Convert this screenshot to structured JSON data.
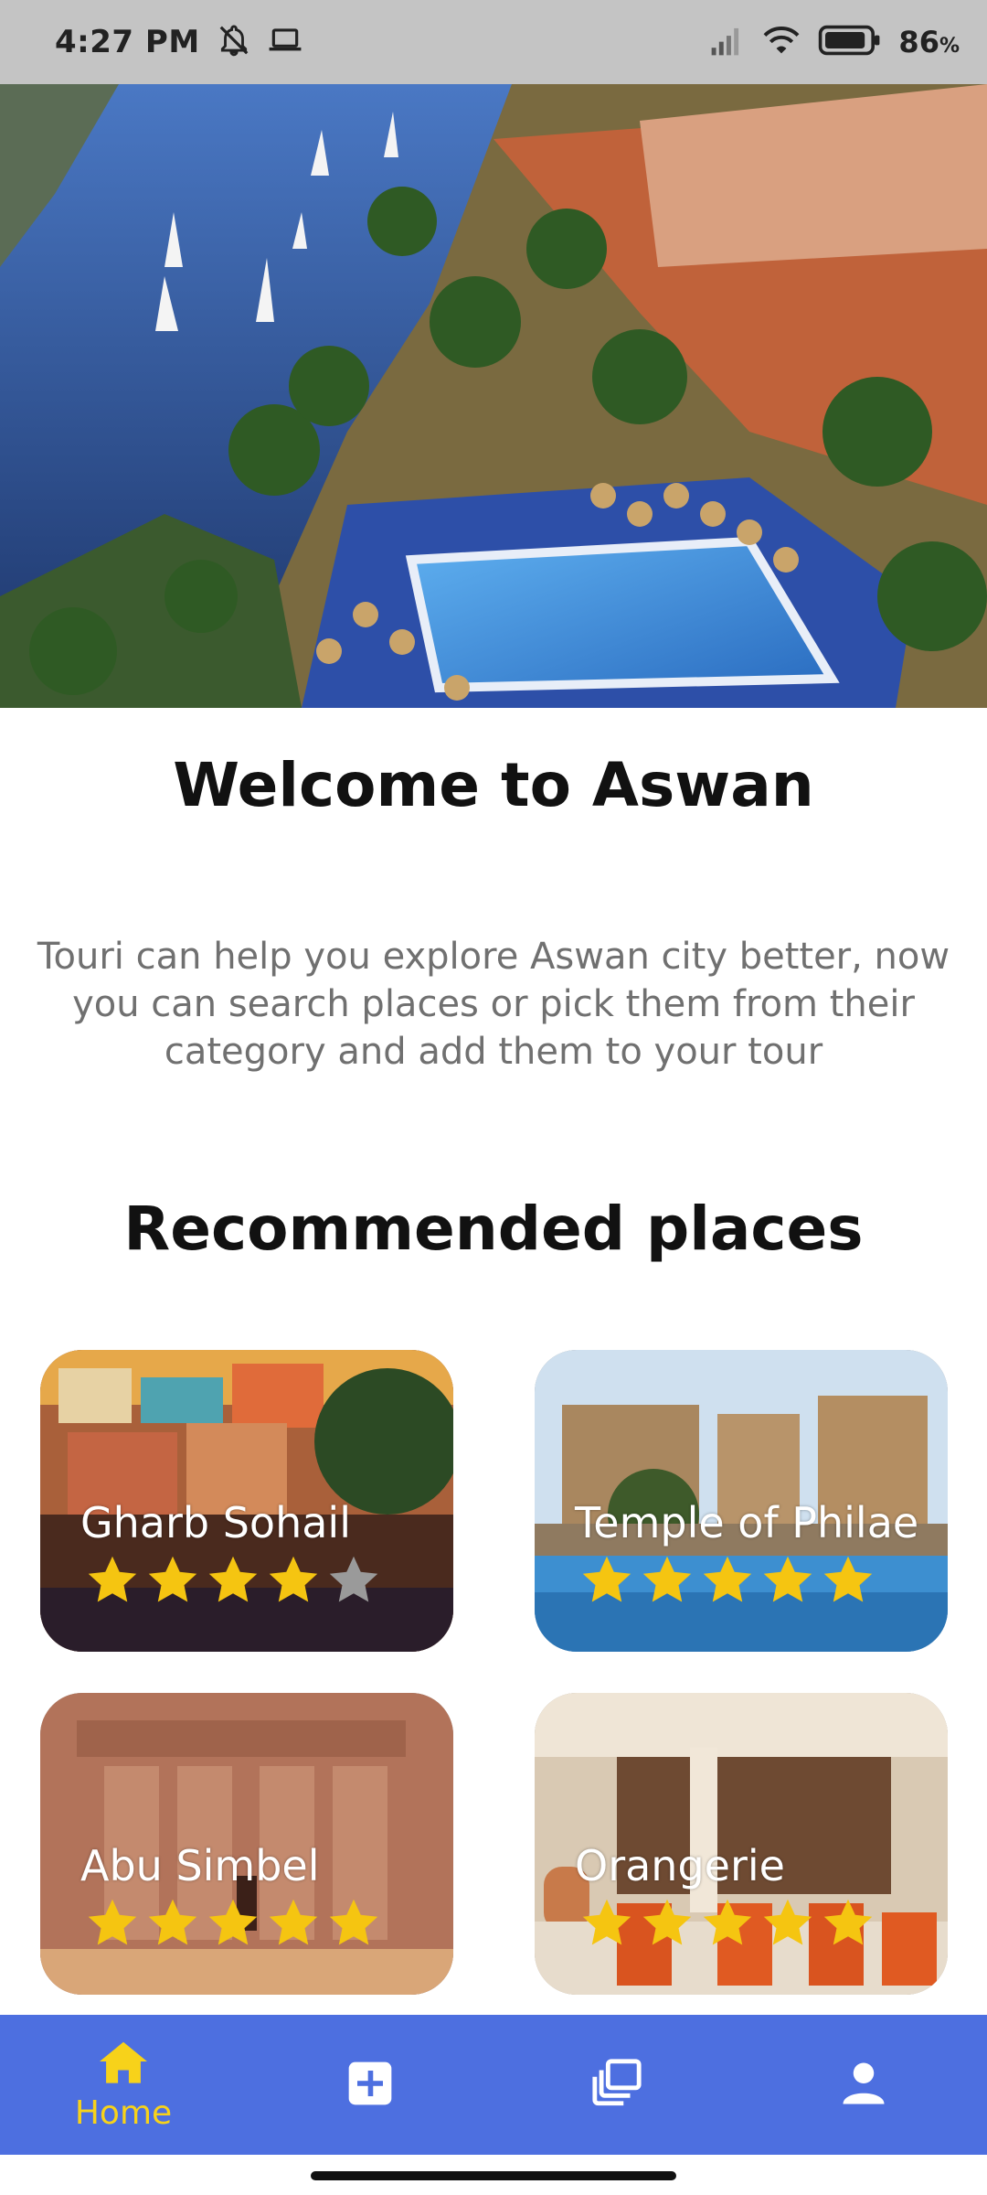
{
  "status_bar": {
    "time": "4:27 PM",
    "battery": "86",
    "battery_unit": "%",
    "icons": [
      "notifications-off-icon",
      "laptop-icon",
      "signal-icon",
      "wifi-icon",
      "battery-icon"
    ]
  },
  "hero": {
    "image": "aswan-nile-resort-photo"
  },
  "welcome": {
    "title": "Welcome to Aswan",
    "text": "Touri can help you explore Aswan city better, now you can search places or pick them from their category and add them to your tour"
  },
  "recommended": {
    "title": "Recommended places",
    "places": [
      {
        "name": "Gharb Sohail",
        "rating": 4,
        "max_rating": 5
      },
      {
        "name": "Temple of Philae",
        "rating": 5,
        "max_rating": 5
      },
      {
        "name": "Abu Simbel",
        "rating": 5,
        "max_rating": 5
      },
      {
        "name": "Orangerie",
        "rating": 5,
        "max_rating": 5
      }
    ]
  },
  "bottom_nav": {
    "items": [
      {
        "label": "Home",
        "icon": "home-icon",
        "active": true
      },
      {
        "label": "",
        "icon": "add-box-icon",
        "active": false
      },
      {
        "label": "",
        "icon": "collections-icon",
        "active": false
      },
      {
        "label": "",
        "icon": "person-icon",
        "active": false
      }
    ]
  },
  "colors": {
    "nav_background": "#4d6fe0",
    "nav_active": "#f7d21a",
    "star_filled": "#f5c511",
    "star_empty": "#9a9a9a",
    "status_bar": "#c4c4c4"
  }
}
